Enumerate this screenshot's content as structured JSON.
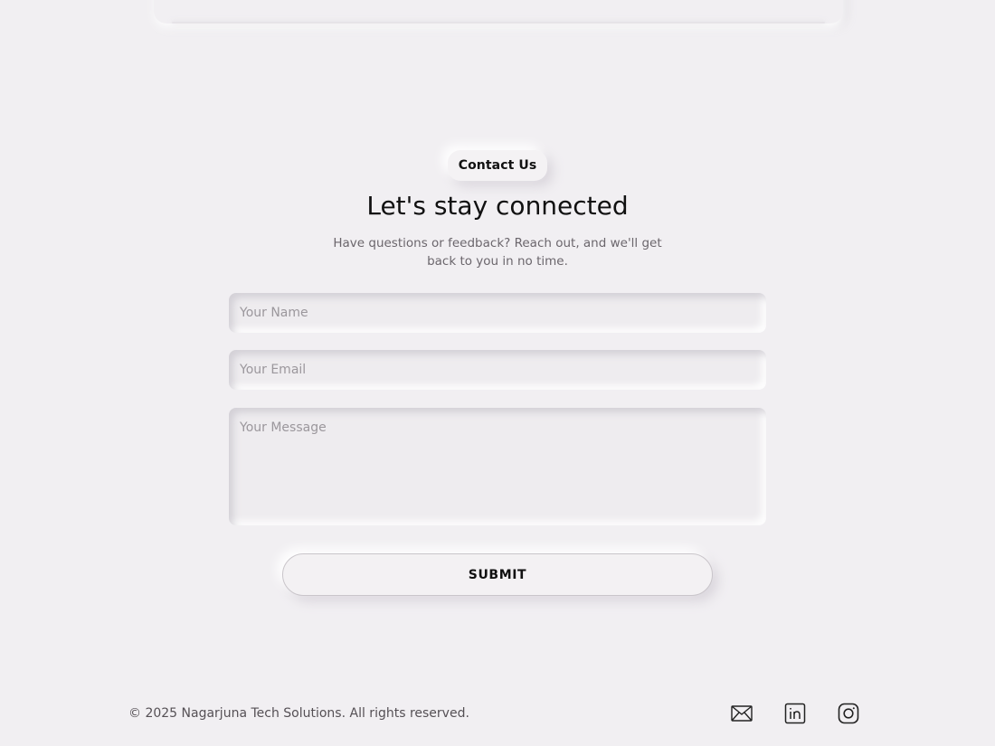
{
  "contact": {
    "badge": "Contact Us",
    "heading": "Let's stay connected",
    "subtext": "Have questions or feedback? Reach out, and we'll get back to you in no time."
  },
  "form": {
    "name_placeholder": "Your Name",
    "email_placeholder": "Your Email",
    "message_placeholder": "Your Message",
    "submit_label": "SUBMIT"
  },
  "footer": {
    "copyright": "© 2025 Nagarjuna Tech Solutions. All rights reserved.",
    "social": [
      {
        "icon": "mail-icon"
      },
      {
        "icon": "linkedin-icon"
      },
      {
        "icon": "instagram-icon"
      }
    ]
  },
  "colors": {
    "background": "#f1eff2",
    "text": "#111111",
    "muted": "#6b666c"
  }
}
